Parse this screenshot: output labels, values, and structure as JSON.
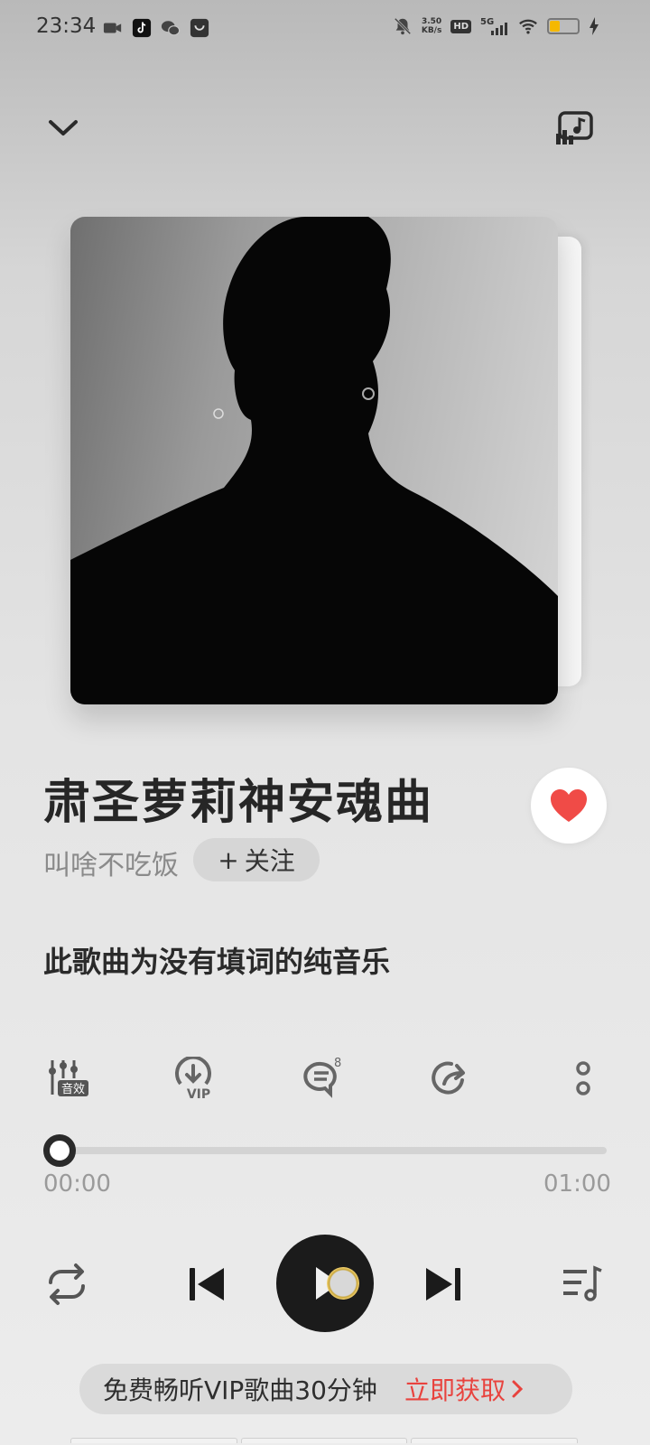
{
  "status_bar": {
    "time": "23:34",
    "speed_value": "3.50",
    "speed_unit": "KB/s",
    "hd": "HD",
    "network": "5G",
    "left_icons": [
      "video-camera-icon",
      "tiktok-icon",
      "wechat-icon",
      "shopping-bag-icon"
    ],
    "right_icons": [
      "mute-bell-icon",
      "signal-icon",
      "wifi-icon",
      "battery-icon",
      "charging-icon"
    ],
    "battery_level": 0.35,
    "battery_color": "#f5b800"
  },
  "header": {
    "collapse_icon": "chevron-down-icon",
    "cast_icon": "music-cast-icon"
  },
  "song": {
    "title": "肃圣萝莉神安魂曲",
    "artist": "叫啥不吃饭",
    "follow_label": "关注",
    "follow_prefix": "+",
    "liked": true,
    "like_color": "#f04b47",
    "lyrics_note": "此歌曲为没有填词的纯音乐"
  },
  "functions": [
    {
      "name": "sound-effect",
      "label": "音效"
    },
    {
      "name": "download-vip",
      "label": "VIP"
    },
    {
      "name": "comments",
      "badge": "8"
    },
    {
      "name": "share"
    },
    {
      "name": "more"
    }
  ],
  "progress": {
    "current": "00:00",
    "total": "01:00",
    "fraction": 0
  },
  "controls": {
    "repeat": "repeat-icon",
    "previous": "previous-icon",
    "play": "play-icon",
    "next": "next-icon",
    "playlist": "playlist-icon"
  },
  "vip_banner": {
    "text": "免费畅听VIP歌曲30分钟",
    "action": "立即获取",
    "action_color": "#e8433e"
  }
}
